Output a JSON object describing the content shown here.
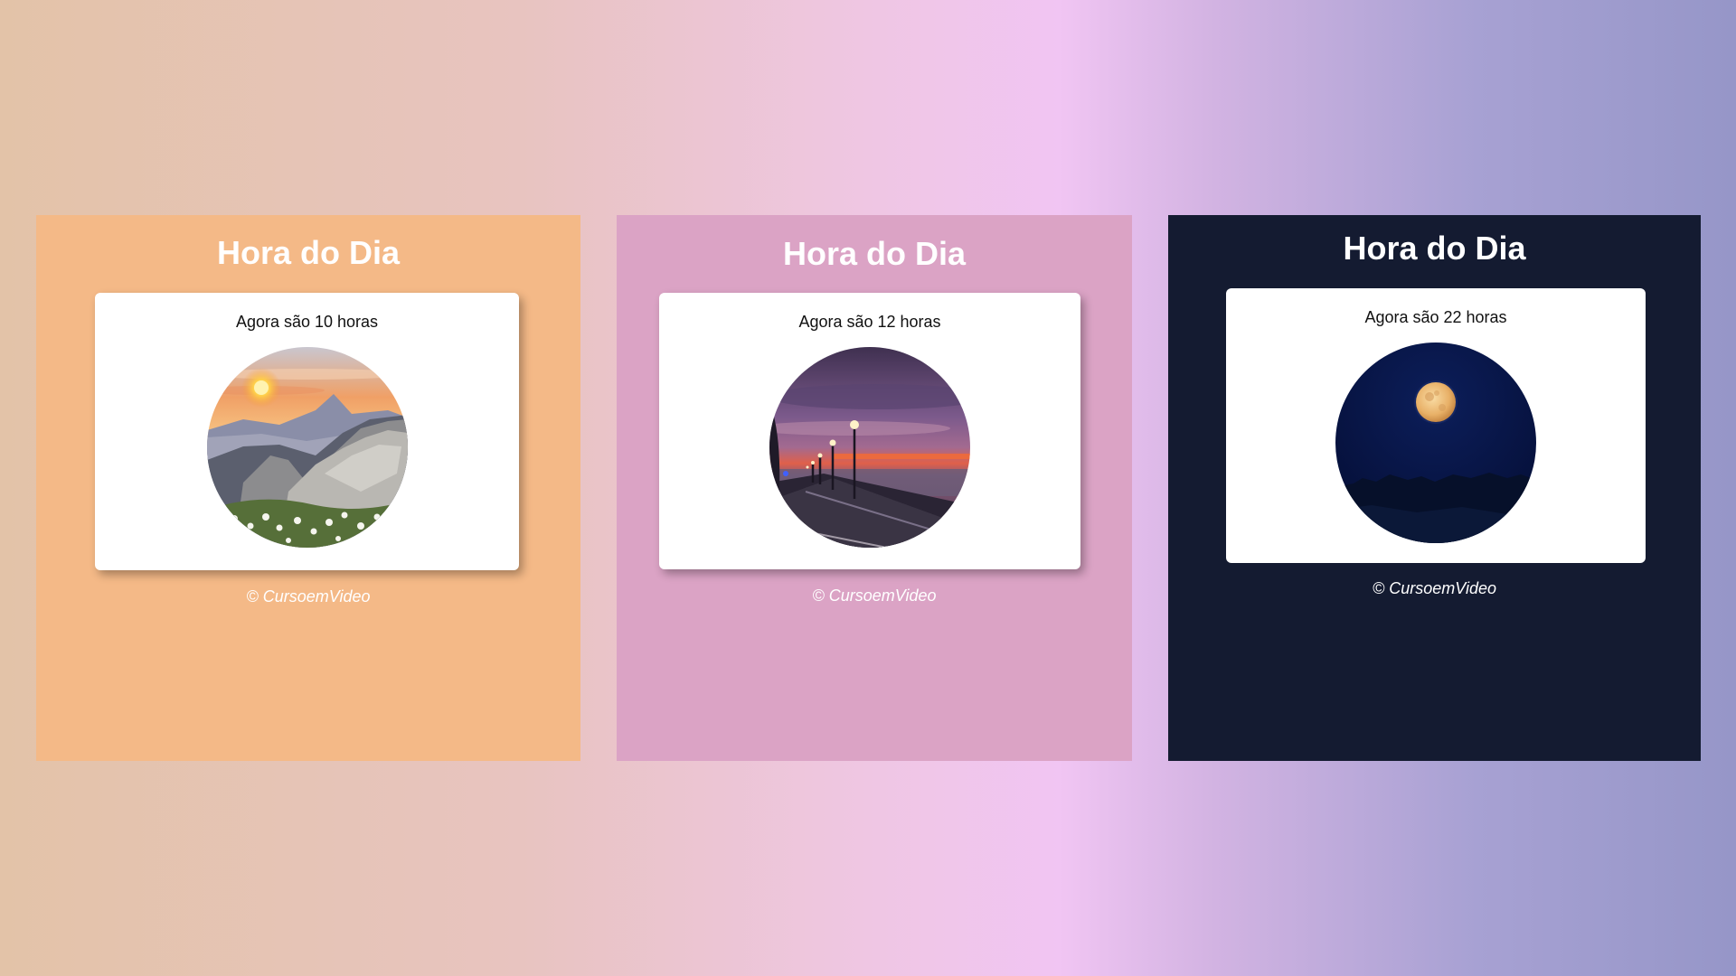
{
  "page": {
    "background_colors": [
      "#e3c3a8",
      "#efc6e3",
      "#f1c5f3",
      "#9696c8"
    ]
  },
  "panels": [
    {
      "title": "Hora do Dia",
      "text": "Agora são 10 horas",
      "footer": "© CursoemVideo",
      "background": "#f4b987",
      "image": "morning-mountain-sunrise"
    },
    {
      "title": "Hora do Dia",
      "text": "Agora são 12 horas",
      "footer": "© CursoemVideo",
      "background": "#dba3c5",
      "image": "dusk-seaside-promenade-streetlamps"
    },
    {
      "title": "Hora do Dia",
      "text": "Agora são 22 horas",
      "footer": "© CursoemVideo",
      "background": "#141b31",
      "image": "night-full-moon"
    }
  ]
}
